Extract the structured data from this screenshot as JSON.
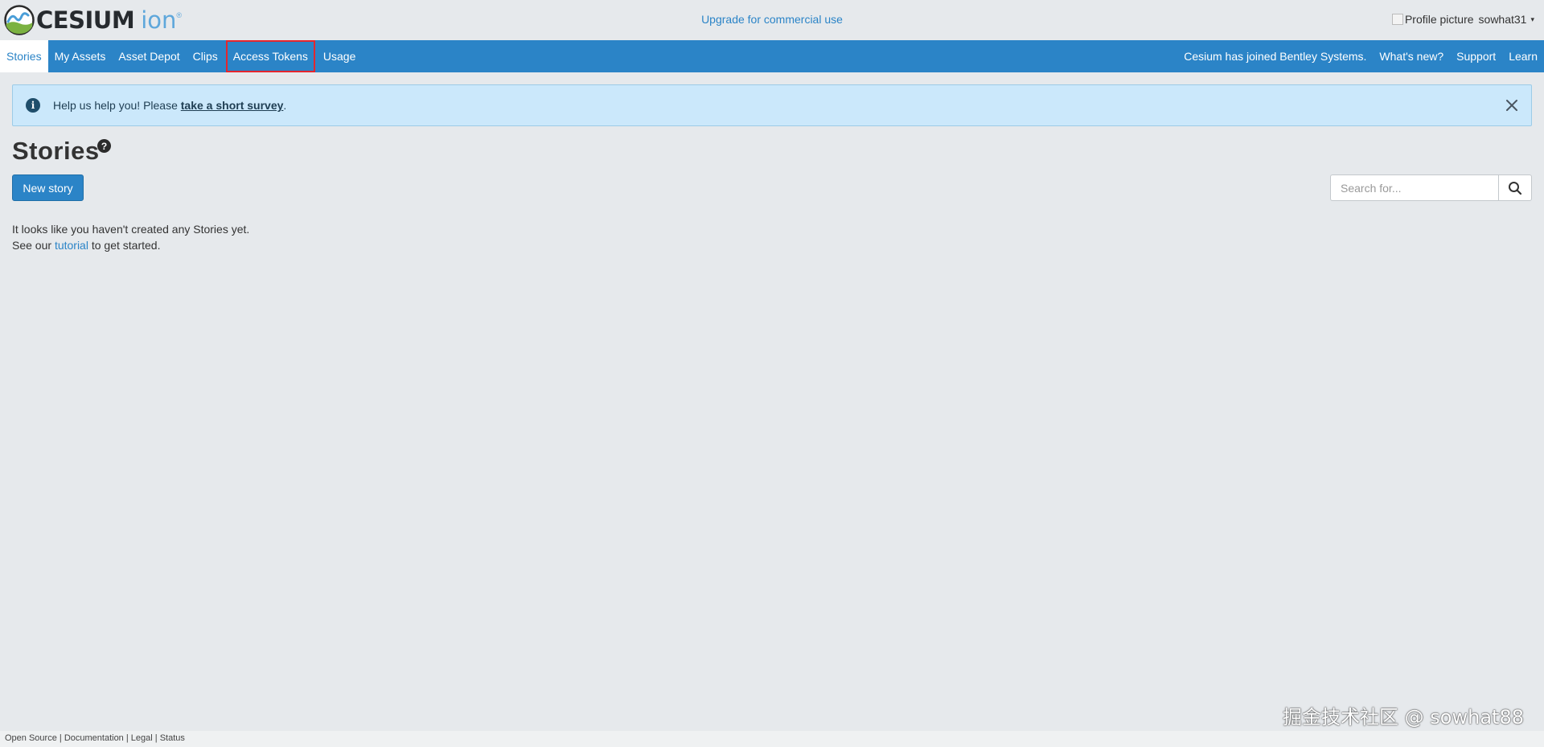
{
  "header": {
    "logo_text": "CESIUM",
    "logo_ion": "ion",
    "logo_reg": "®",
    "upgrade_link": "Upgrade for commercial use",
    "profile_alt": "Profile picture",
    "username": "sowhat31",
    "caret": "▾"
  },
  "nav": {
    "left": [
      {
        "label": "Stories",
        "active": true
      },
      {
        "label": "My Assets"
      },
      {
        "label": "Asset Depot"
      },
      {
        "label": "Clips"
      },
      {
        "label": "Access Tokens",
        "highlighted": true
      },
      {
        "label": "Usage"
      }
    ],
    "right": [
      {
        "label": "Cesium has joined Bentley Systems."
      },
      {
        "label": "What's new?"
      },
      {
        "label": "Support"
      },
      {
        "label": "Learn"
      }
    ]
  },
  "alert": {
    "prefix": "Help us help you! Please ",
    "link": "take a short survey",
    "suffix": ".",
    "icon": "i"
  },
  "page": {
    "title": "Stories",
    "help_icon": "?",
    "new_story_label": "New story",
    "search_placeholder": "Search for...",
    "empty_line1": "It looks like you haven't created any Stories yet.",
    "empty_line2_prefix": "See our ",
    "empty_line2_link": "tutorial",
    "empty_line2_suffix": " to get started."
  },
  "footer": {
    "links": [
      "Open Source",
      "Documentation",
      "Legal",
      "Status"
    ],
    "separator": " | "
  },
  "watermark": "掘金技术社区 @ sowhat88",
  "colors": {
    "accent": "#2b84c7",
    "background": "#e6e9ec",
    "alert_bg": "#cbe8fb",
    "highlight": "#e5262e"
  }
}
